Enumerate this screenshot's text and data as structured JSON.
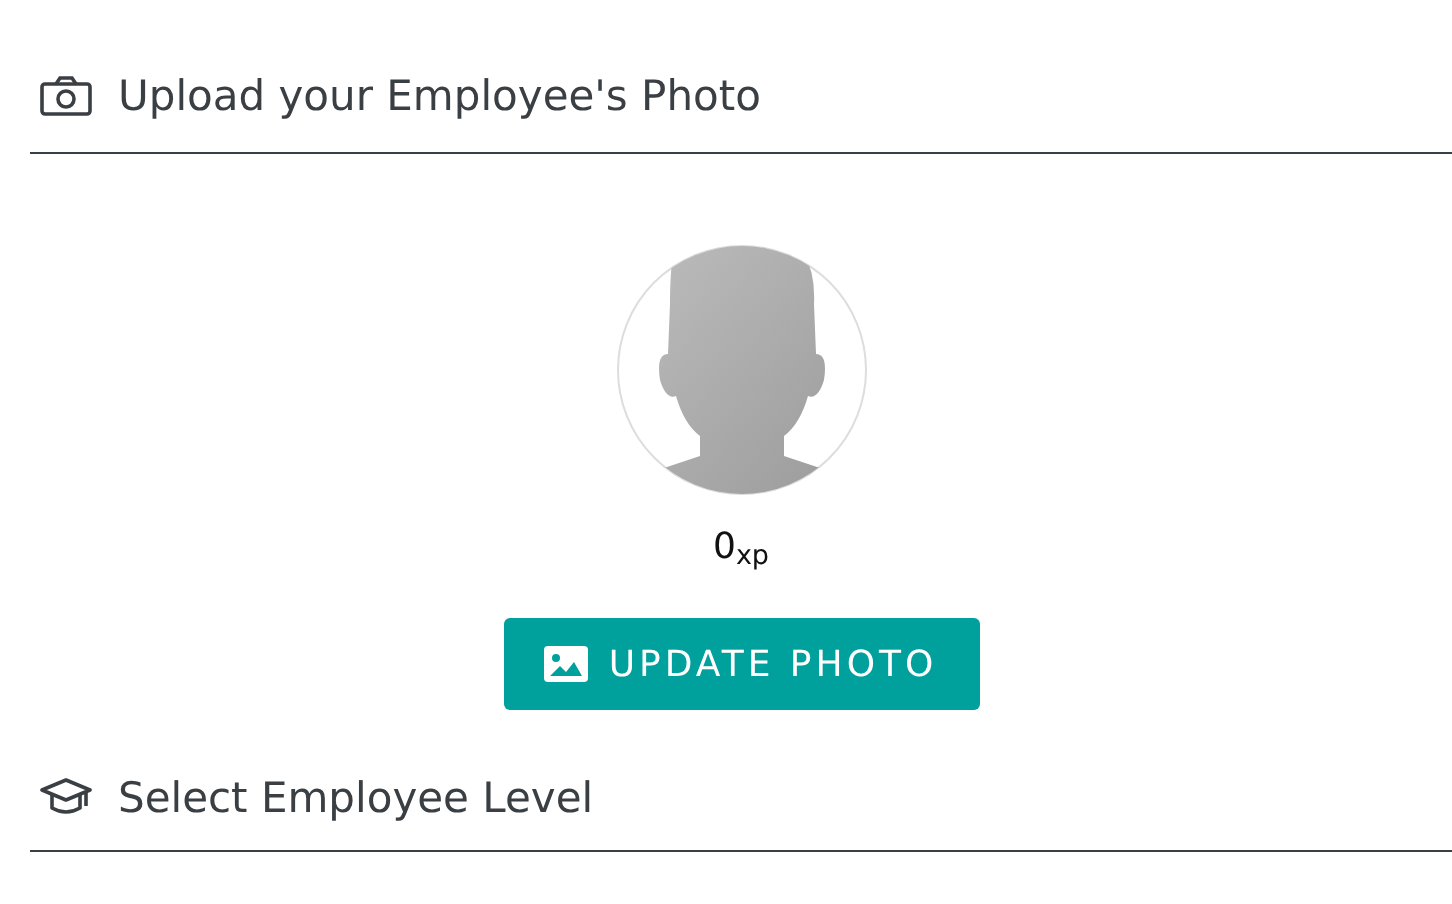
{
  "sections": [
    {
      "kind": "photo",
      "title": "Upload your Employee's Photo",
      "points": "0$_{xp}$",
      "button": "UPDATE PHOTO"
    },
    {
      "kind": "level",
      "title": "Select Employee Level"
    }
  ]
}
